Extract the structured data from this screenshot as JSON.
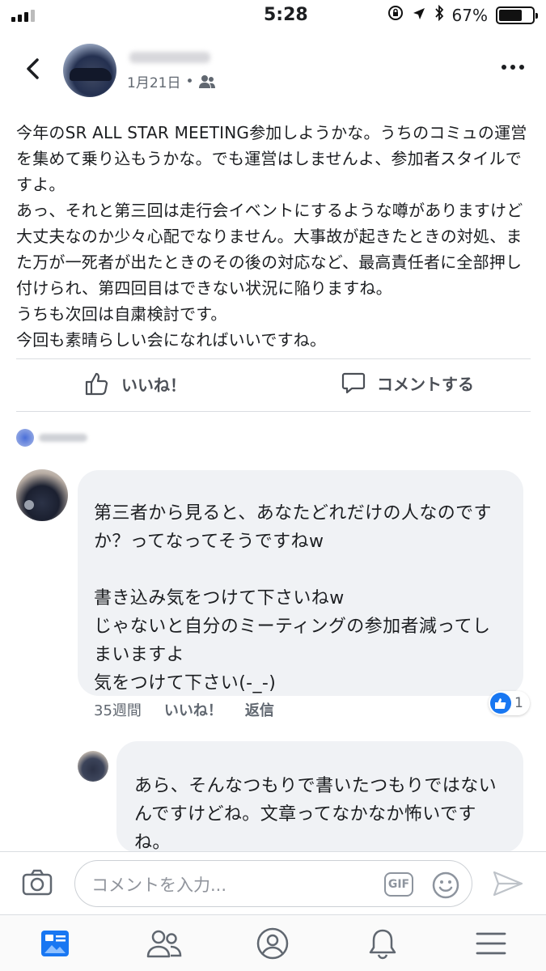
{
  "status_bar": {
    "time": "5:28",
    "battery_percent": "67%",
    "battery_level": 0.67
  },
  "post": {
    "date": "1月21日",
    "separator": "•",
    "text": "今年のSR ALL STAR  MEETING参加しようかな。うちのコミュの運営を集めて乗り込もうかな。でも運営はしませんよ、参加者スタイルですよ。\nあっ、それと第三回は走行会イベントにするような噂がありますけど大丈夫なのか少々心配でなりません。大事故が起きたときの対処、また万が一死者が出たときのその後の対応など、最高責任者に全部押し付けられ、第四回目はできない状況に陥りますね。\nうちも次回は自粛検討です。\n今回も素晴らしい会になればいいですね。"
  },
  "actions": {
    "like": "いいね！",
    "comment": "コメントする"
  },
  "comments": [
    {
      "text": "第三者から見ると、あなたどれだけの人なのですか？ってなってそうですねw\n\n書き込み気をつけて下さいねw\nじゃないと自分のミーティングの参加者減ってしまいますよ\n気をつけて下さい(-_-)",
      "time": "35週間",
      "like_label": "いいね！",
      "reply_label": "返信",
      "reaction_count": "1"
    },
    {
      "text": "あら、そんなつもりで書いたつもりではないんですけどね。文章ってなかなか怖いですね。"
    }
  ],
  "comment_input": {
    "placeholder": "コメントを入力...",
    "gif_label": "GIF"
  },
  "icons": {
    "back": "chevron-left-icon",
    "audience": "friends-icon",
    "more": "ellipsis-icon",
    "like": "thumbs-up-icon",
    "comment": "comment-bubble-icon",
    "camera": "camera-icon",
    "emoji": "smiley-icon",
    "send": "send-icon",
    "tabs": [
      "news-feed-icon",
      "friends-icon",
      "profile-icon",
      "bell-icon",
      "menu-icon"
    ]
  },
  "colors": {
    "accent": "#1877f2",
    "bubble": "#f0f2f5",
    "muted_text": "#606770"
  }
}
